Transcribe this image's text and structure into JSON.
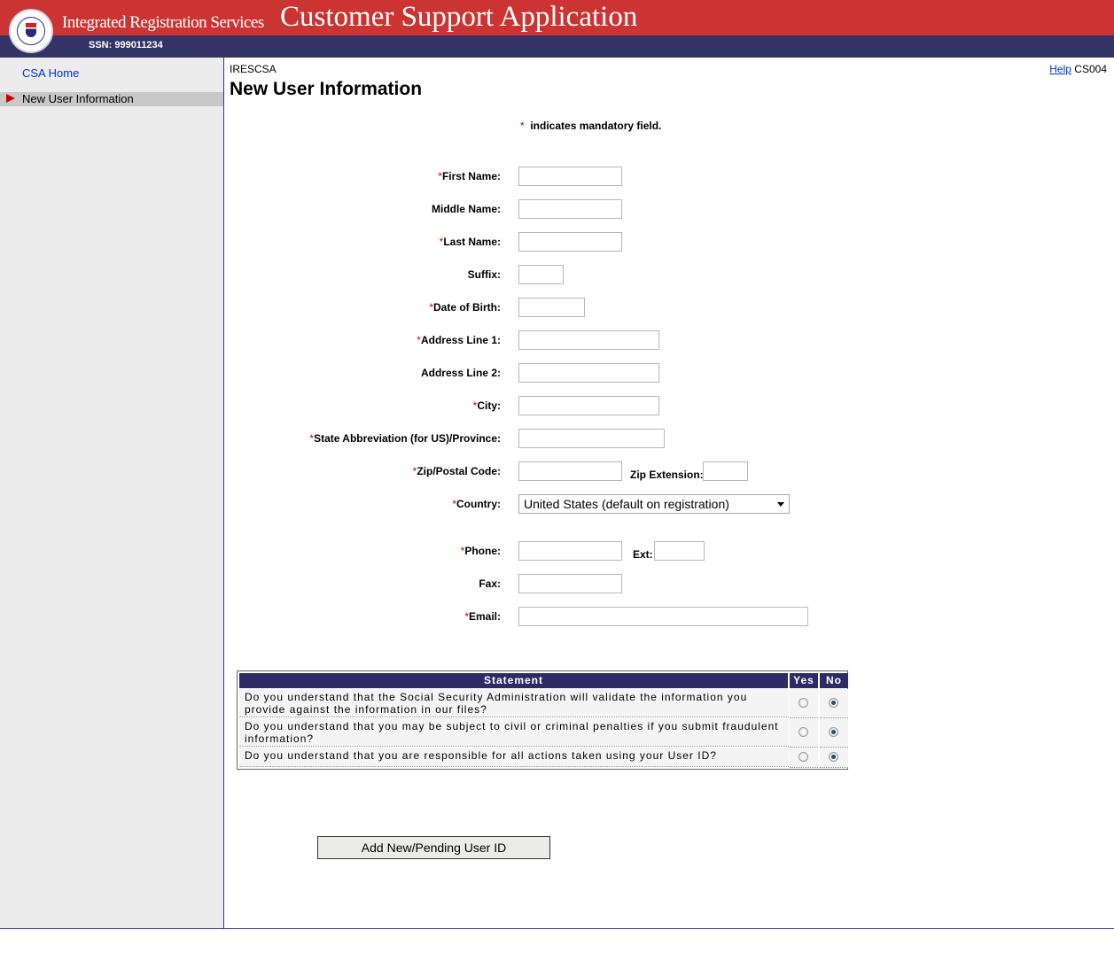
{
  "header": {
    "brand": "Integrated Registration Services",
    "app_title": "Customer Support Application",
    "ssn": "SSN: 999011234",
    "colors": {
      "top_bar": "#cc3333",
      "sub_bar": "#333366"
    }
  },
  "sidebar": {
    "home_label": "CSA Home",
    "active_label": "New User Information"
  },
  "main": {
    "crumb": "IRESCSA",
    "help_label": "Help",
    "screen_id": "CS004",
    "title": "New User Information",
    "mandatory_star": "*",
    "mandatory_note": "indicates mandatory field."
  },
  "form": {
    "first_name": {
      "label": "First Name:",
      "required": true,
      "value": ""
    },
    "middle_name": {
      "label": "Middle Name:",
      "required": false,
      "value": ""
    },
    "last_name": {
      "label": "Last Name:",
      "required": true,
      "value": ""
    },
    "suffix": {
      "label": "Suffix:",
      "required": false,
      "value": ""
    },
    "dob": {
      "label": "Date of Birth:",
      "required": true,
      "value": ""
    },
    "address1": {
      "label": "Address Line 1:",
      "required": true,
      "value": ""
    },
    "address2": {
      "label": "Address Line 2:",
      "required": false,
      "value": ""
    },
    "city": {
      "label": "City:",
      "required": true,
      "value": ""
    },
    "state": {
      "label": "State Abbreviation (for US)/Province:",
      "required": true,
      "value": ""
    },
    "zip": {
      "label": "Zip/Postal Code:",
      "required": true,
      "value": ""
    },
    "zip_ext": {
      "label": "Zip Extension:",
      "value": ""
    },
    "country": {
      "label": "Country:",
      "required": true,
      "selected": "United States (default on registration)"
    },
    "phone": {
      "label": "Phone:",
      "required": true,
      "value": ""
    },
    "phone_ext": {
      "label": "Ext:",
      "value": ""
    },
    "fax": {
      "label": "Fax:",
      "required": false,
      "value": ""
    },
    "email": {
      "label": "Email:",
      "required": true,
      "value": ""
    }
  },
  "statements": {
    "headers": {
      "statement": "Statement",
      "yes": "Yes",
      "no": "No"
    },
    "rows": [
      {
        "text": "Do you understand that the Social Security Administration will validate the information you provide against the information in our files?",
        "answer": "No"
      },
      {
        "text": "Do you understand that you may be subject to civil or criminal penalties if you submit fraudulent information?",
        "answer": "No"
      },
      {
        "text": "Do you understand that you are responsible for all actions taken using your User ID?",
        "answer": "No"
      }
    ]
  },
  "submit_label": "Add New/Pending User ID"
}
